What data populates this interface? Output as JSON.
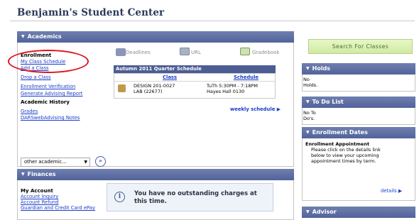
{
  "page_title": "Benjamin's Student Center",
  "academics": {
    "header": "Academics",
    "enrollment_label": "Enrollment",
    "links": [
      "My Class Schedule",
      "Add a Class",
      "Drop a Class",
      "Enrollment Verification",
      "Generate Advising Report"
    ],
    "academic_history_label": "Academic History",
    "history_links": [
      "Grades",
      "DARSwebAdvising Notes"
    ],
    "other_select": "other academic...",
    "tools": [
      "Deadlines",
      "URL",
      "Gradebook"
    ],
    "schedule": {
      "title": "Autumn 2011 Quarter Schedule",
      "columns": [
        "Class",
        "Schedule"
      ],
      "rows": [
        {
          "class": "DESIGN 201-0027",
          "schedule": "TuTh 5:30PM - 7:18PM"
        },
        {
          "class": "LAB (22677)",
          "schedule": "Hayes Hall 0130"
        }
      ],
      "weekly_link": "weekly schedule"
    }
  },
  "finances": {
    "header": "Finances",
    "my_account_label": "My Account",
    "links": [
      "Account Inquiry",
      "Account Refund",
      "Guardian and Credit Card ePay"
    ],
    "message": "You have no outstanding charges at this time."
  },
  "right": {
    "search_button": "Search For Classes",
    "holds": {
      "header": "Holds",
      "text": [
        "No",
        "Holds."
      ]
    },
    "todo": {
      "header": "To Do List",
      "text": [
        "No To",
        "Do's."
      ]
    },
    "enrollment_dates": {
      "header": "Enrollment Dates",
      "title": "Enrollment Appointment",
      "text": [
        "Please click on the details link",
        "below to view your upcoming",
        "appointment times by term."
      ],
      "details_link": "details"
    },
    "advisor": {
      "header": "Advisor"
    }
  },
  "colors": {
    "header_blue": "#52639a",
    "link_blue": "#1a3cc8",
    "highlight_red": "#e0141e",
    "search_green": "#cfeba3"
  }
}
